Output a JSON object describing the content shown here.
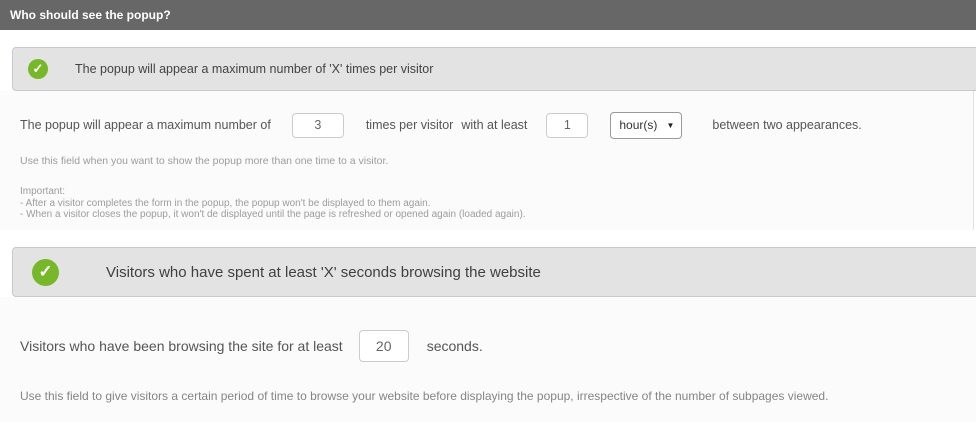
{
  "header": {
    "title": "Who should see the popup?"
  },
  "colors": {
    "accent_green": "#76b82a",
    "header_bg": "#676767",
    "bar_bg": "#e3e3e3"
  },
  "sections": [
    {
      "title": "The popup will appear a maximum number of 'X' times per visitor",
      "row": {
        "text_before": "The popup will appear a maximum number of",
        "max_times_value": "3",
        "text_middle_1": "times per visitor",
        "text_middle_2": "with at least",
        "interval_value": "1",
        "interval_unit": "hour(s)",
        "select_arrow": "▼",
        "text_after": "between two appearances."
      },
      "help": "Use this field when you want to show the popup more than one time to a visitor.",
      "important_title": "Important:",
      "important_lines": [
        "- After a visitor completes the form in the popup, the popup won't be displayed to them again.",
        "- When a visitor closes the popup, it won't de displayed until the page is refreshed or opened again (loaded again)."
      ],
      "check_glyph": "✓"
    },
    {
      "title": "Visitors who have spent at least 'X' seconds browsing the website",
      "row": {
        "text_before": "Visitors who have been browsing the site for at least",
        "seconds_value": "20",
        "text_after": "seconds."
      },
      "help": "Use this field to give visitors a certain period of time to browse your website before displaying the popup, irrespective of the number of subpages viewed.",
      "check_glyph": "✓"
    }
  ]
}
